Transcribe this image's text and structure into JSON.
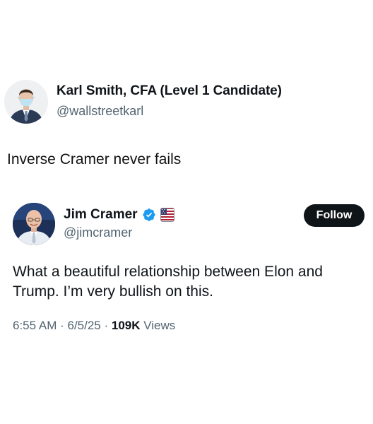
{
  "outer_post": {
    "author_name": "Karl Smith, CFA (Level 1 Candidate)",
    "author_handle": "@wallstreetkarl",
    "text": "Inverse Cramer never fails"
  },
  "quoted_post": {
    "author_name": "Jim Cramer",
    "author_handle": "@jimcramer",
    "verified_icon": "verified-badge-icon",
    "affiliation_icon": "us-flag-badge-icon",
    "follow_label": "Follow",
    "text": "What a beautiful relationship between Elon and Trump. I’m very bullish on this.",
    "time": "6:55 AM",
    "separator": " · ",
    "date": "6/5/25",
    "views_count": "109K",
    "views_label": " Views"
  },
  "colors": {
    "text": "#0f1419",
    "secondary": "#536471",
    "verified": "#1d9bf0",
    "button_bg": "#0f1419"
  }
}
